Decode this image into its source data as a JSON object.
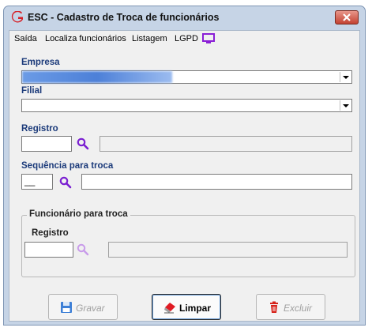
{
  "window": {
    "title": "ESC - Cadastro de Troca de funcionários"
  },
  "menu": [
    {
      "label": "Saída",
      "name": "menu-saida"
    },
    {
      "label": "Localiza funcionários",
      "name": "menu-localiza-funcionarios"
    },
    {
      "label": "Listagem",
      "name": "menu-listagem"
    },
    {
      "label": "LGPD",
      "name": "menu-lgpd"
    }
  ],
  "form": {
    "empresa_label": "Empresa",
    "filial_label": "Filial",
    "registro_label": "Registro",
    "sequencia_label": "Sequência para troca",
    "sequencia_value": "__",
    "group_title": "Funcionário para troca",
    "group_registro_label": "Registro"
  },
  "buttons": {
    "gravar": "Gravar",
    "limpar": "Limpar",
    "excluir": "Excluir"
  },
  "colors": {
    "accent": "#1b3a7a",
    "lookup_icon": "#7a1fd1",
    "delete_icon": "#d6221a"
  }
}
